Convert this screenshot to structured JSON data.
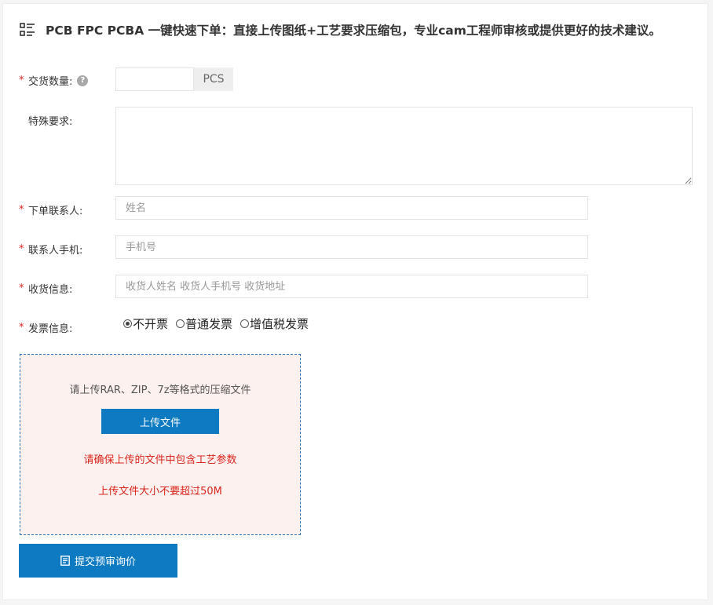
{
  "header": {
    "title": "PCB FPC PCBA 一键快速下单：直接上传图纸+工艺要求压缩包，专业cam工程师审核或提供更好的技术建议。",
    "icon": "document-list-icon"
  },
  "form": {
    "required_mark": "*",
    "quantity": {
      "label": "交货数量:",
      "value": "",
      "unit": "PCS",
      "help": "?"
    },
    "special": {
      "label": "特殊要求:",
      "value": ""
    },
    "contact_name": {
      "label": "下单联系人:",
      "placeholder": "姓名",
      "value": ""
    },
    "contact_phone": {
      "label": "联系人手机:",
      "placeholder": "手机号",
      "value": ""
    },
    "shipping": {
      "label": "收货信息:",
      "placeholder": "收货人姓名 收货人手机号 收货地址",
      "value": ""
    },
    "invoice": {
      "label": "发票信息:",
      "options": [
        {
          "label": "不开票",
          "checked": true
        },
        {
          "label": "普通发票",
          "checked": false
        },
        {
          "label": "增值税发票",
          "checked": false
        }
      ]
    }
  },
  "upload": {
    "hint": "请上传RAR、ZIP、7z等格式的压缩文件",
    "button_label": "上传文件",
    "warning_1": "请确保上传的文件中包含工艺参数",
    "warning_2": "上传文件大小不要超过50M"
  },
  "submit": {
    "label": "提交预审询价",
    "icon": "form-icon"
  },
  "colors": {
    "primary": "#0d7ac2",
    "required": "#d9251c",
    "upload_bg": "#fdf1ef",
    "upload_border": "#2b6fb3"
  }
}
